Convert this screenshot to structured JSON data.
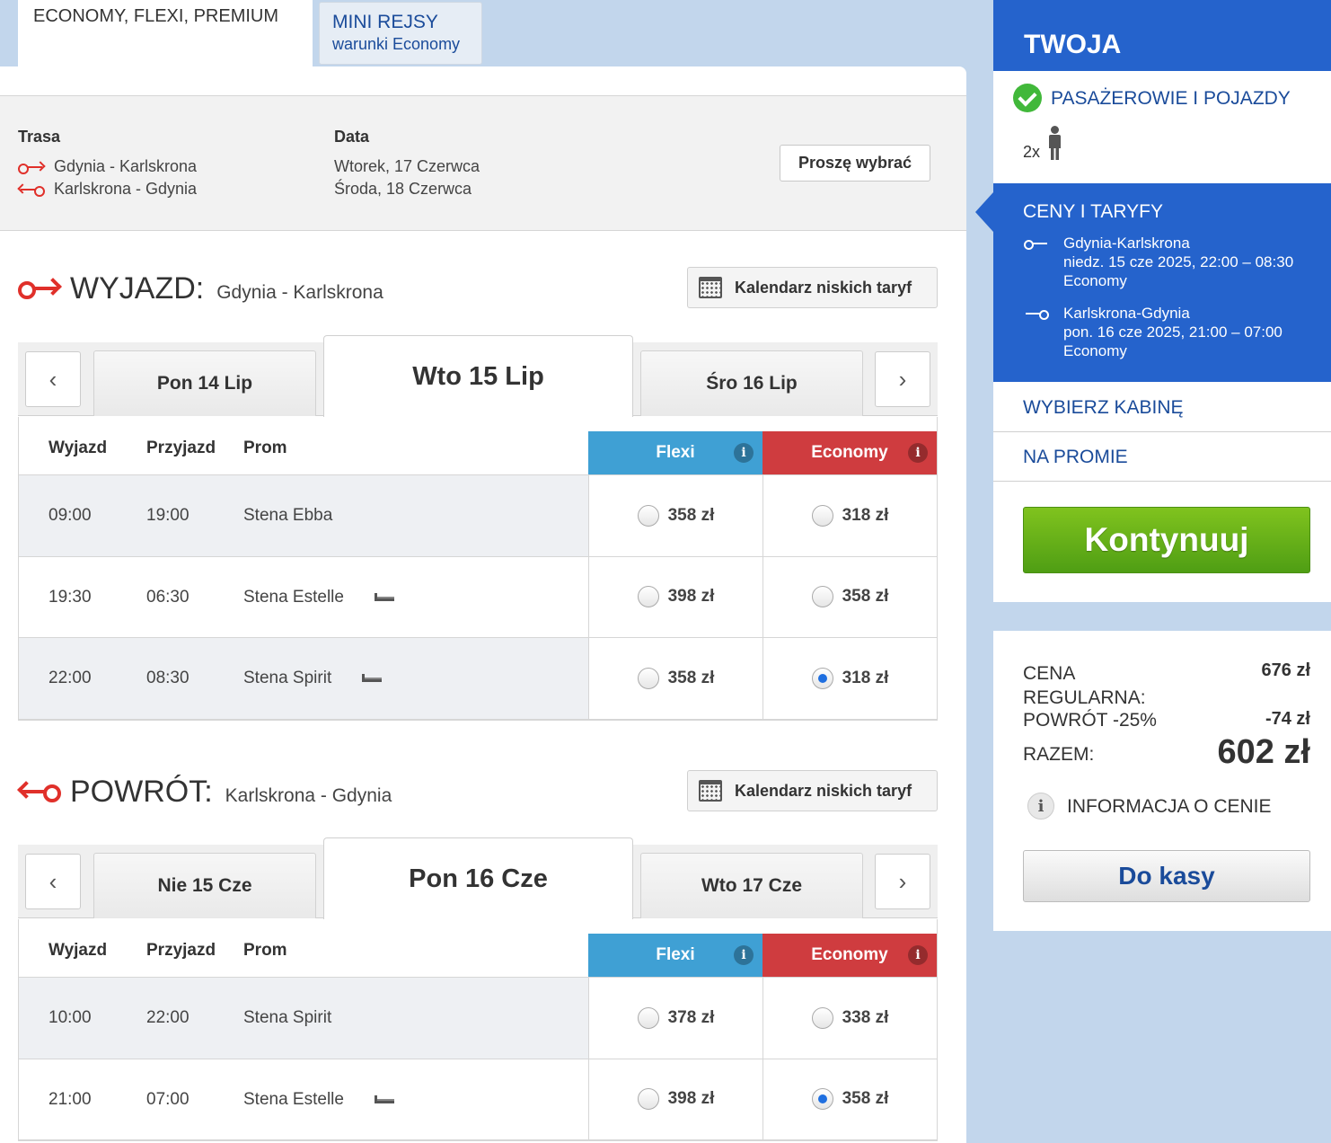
{
  "tabs": [
    {
      "label": "ECONOMY, FLEXI, PREMIUM"
    },
    {
      "label": "MINI REJSY",
      "sub": "warunki Economy"
    }
  ],
  "summary": {
    "route_head": "Trasa",
    "date_head": "Data",
    "out_route": "Gdynia - Karlskrona",
    "ret_route": "Karlskrona - Gdynia",
    "out_date": "Wtorek, 17 Czerwca",
    "ret_date": "Środa, 18 Czerwca",
    "select_btn": "Proszę wybrać"
  },
  "outbound": {
    "title": "WYJAZD:",
    "route": "Gdynia - Karlskrona",
    "calendar_btn": "Kalendarz niskich taryf",
    "dates": {
      "prev": "Pon 14 Lip",
      "active": "Wto 15 Lip",
      "next": "Śro 16 Lip"
    },
    "headers": {
      "dep": "Wyjazd",
      "arr": "Przyjazd",
      "ship": "Prom",
      "flexi": "Flexi",
      "econ": "Economy"
    },
    "rows": [
      {
        "dep": "09:00",
        "arr": "19:00",
        "ship": "Stena Ebba",
        "flexi": "358 zł",
        "econ": "318 zł"
      },
      {
        "dep": "19:30",
        "arr": "06:30",
        "ship": "Stena Estelle",
        "flexi": "398 zł",
        "econ": "358 zł"
      },
      {
        "dep": "22:00",
        "arr": "08:30",
        "ship": "Stena Spirit",
        "flexi": "358 zł",
        "econ": "318 zł"
      }
    ]
  },
  "return": {
    "title": "POWRÓT:",
    "route": "Karlskrona - Gdynia",
    "calendar_btn": "Kalendarz niskich taryf",
    "dates": {
      "prev": "Nie 15 Cze",
      "active": "Pon 16 Cze",
      "next": "Wto 17 Cze"
    },
    "headers": {
      "dep": "Wyjazd",
      "arr": "Przyjazd",
      "ship": "Prom",
      "flexi": "Flexi",
      "econ": "Economy"
    },
    "rows": [
      {
        "dep": "10:00",
        "arr": "22:00",
        "ship": "Stena Spirit",
        "flexi": "378 zł",
        "econ": "338 zł"
      },
      {
        "dep": "21:00",
        "arr": "07:00",
        "ship": "Stena Estelle",
        "flexi": "398 zł",
        "econ": "358 zł"
      }
    ]
  },
  "sidebar": {
    "title": "TWOJA REZERWACJA",
    "step_passengers": "PASAŻEROWIE I POJAZDY",
    "passenger_count": "2x",
    "step_prices": "CENY I TARYFY",
    "leg1": {
      "route": "Gdynia-Karlskrona",
      "when": "niedz. 15 cze 2025, 22:00 – 08:30",
      "fare": "Economy"
    },
    "leg2": {
      "route": "Karlskrona-Gdynia",
      "when": "pon. 16 cze 2025, 21:00 – 07:00",
      "fare": "Economy"
    },
    "step_cabin": "WYBIERZ KABINĘ",
    "step_onboard": "NA PROMIE",
    "continue_btn": "Kontynuuj"
  },
  "price": {
    "regular_label": "CENA REGULARNA:",
    "regular_value": "676 zł",
    "return_label": "POWRÓT -25%",
    "return_value": "-74 zł",
    "total_label": "RAZEM:",
    "total_value": "602 zł",
    "info_label": "INFORMACJA O CENIE",
    "checkout_btn": "Do kasy"
  },
  "colors": {
    "flexi": "#3fa0d4",
    "economy": "#cf3c3f",
    "accent": "#2563cc",
    "continue": "#5aa81a"
  }
}
